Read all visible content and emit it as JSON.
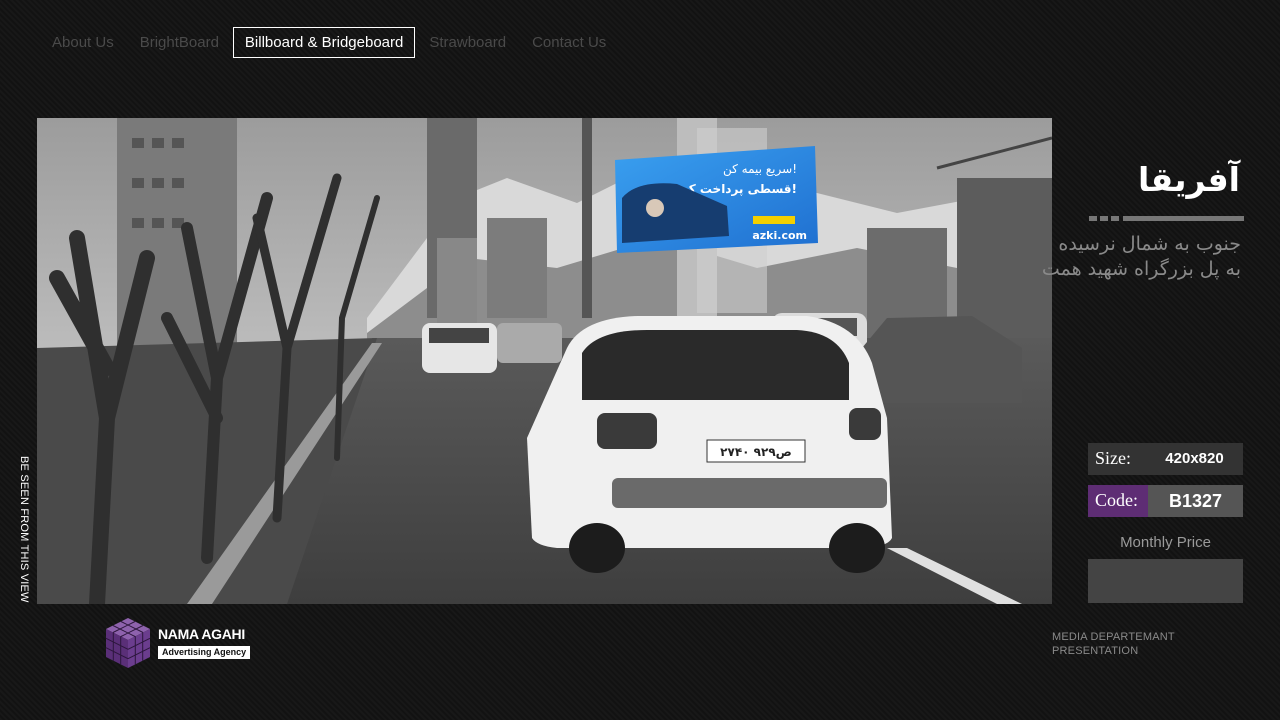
{
  "nav": {
    "items": [
      {
        "label": "About Us",
        "active": false
      },
      {
        "label": "BrightBoard",
        "active": false
      },
      {
        "label": "Billboard & Bridgeboard",
        "active": true
      },
      {
        "label": "Strawboard",
        "active": false
      },
      {
        "label": "Contact Us",
        "active": false
      }
    ]
  },
  "photo": {
    "caption": "BE SEEN FROM THIS VIEW",
    "billboard_ad": {
      "line1": "سریع بیمه کن!",
      "line2": "قسطی پرداخت کن!",
      "brand": "azki.com"
    },
    "plate": "۲۷ص۹۲۹ ۴۰"
  },
  "location": {
    "title": "آفریقا",
    "subtitle": "جنوب به شمال نرسیده به پل بزرگراه شهید همت"
  },
  "specs": {
    "size_label": "Size:",
    "size_value": "420x820",
    "code_label": "Code:",
    "code_value": "B1327",
    "price_label": "Monthly Price",
    "price_value": ""
  },
  "footer": {
    "brand": "NAMA AGAHI",
    "tagline": "Advertising Agency",
    "dept_line1": "MEDIA DEPARTEMANT",
    "dept_line2": "PRESENTATION"
  },
  "colors": {
    "background": "#121212",
    "code_label_bg": "#5e2d74",
    "billboard_blue": "#2a86e0",
    "logo_purple": "#6b3d8e"
  }
}
